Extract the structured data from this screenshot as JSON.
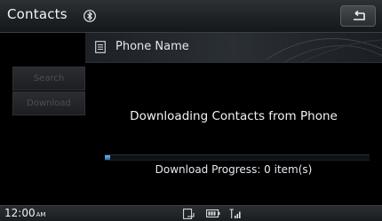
{
  "header": {
    "title": "Contacts",
    "bluetooth_icon": "bluetooth-icon",
    "back_icon": "back-arrow-icon"
  },
  "sidebar": {
    "search_label": "Search",
    "download_label": "Download"
  },
  "phone_bar": {
    "icon": "phonebook-icon",
    "label": "Phone Name"
  },
  "main": {
    "status_message": "Downloading Contacts from Phone",
    "progress_label": "Download  Progress: 0 item(s)",
    "progress_fraction": 0.02
  },
  "statusbar": {
    "time": "12:00",
    "ampm": "AM",
    "icons": [
      "phone-status-icon",
      "battery-icon",
      "signal-icon"
    ]
  },
  "colors": {
    "accent": "#4f9ad8",
    "background": "#000000",
    "header": "#1f2225"
  }
}
